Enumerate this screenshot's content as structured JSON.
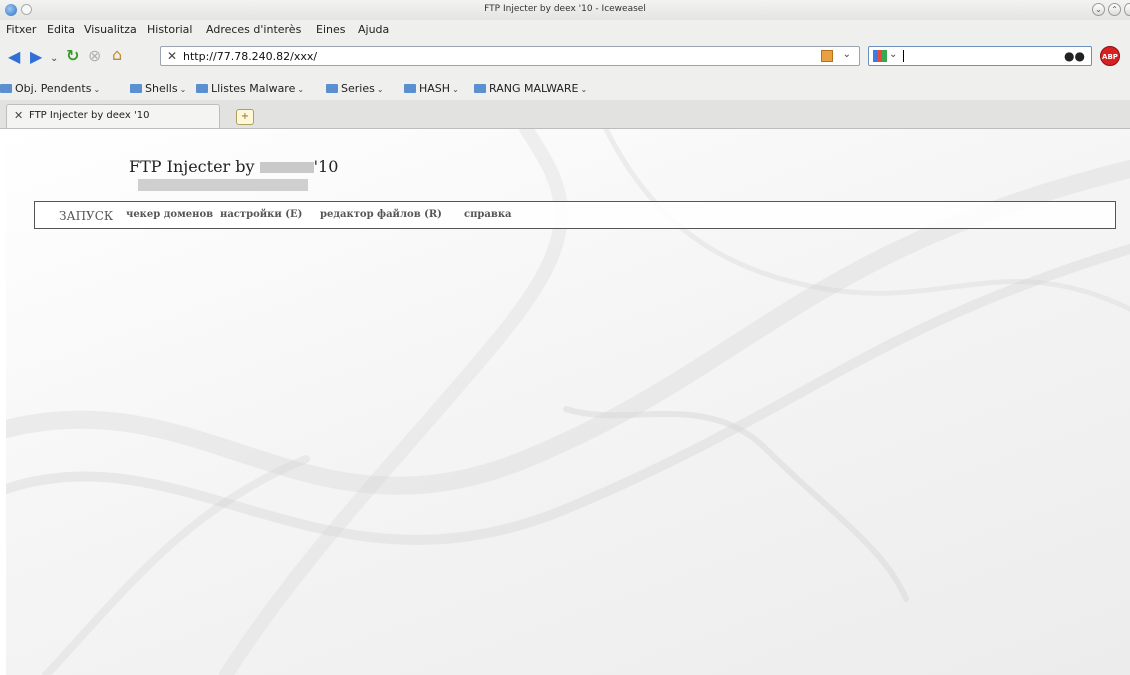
{
  "window": {
    "title": "FTP Injecter by deex '10 - Iceweasel"
  },
  "menu": {
    "items": [
      "Fitxer",
      "Edita",
      "Visualitza",
      "Historial",
      "Adreces d'interès",
      "Eines",
      "Ajuda"
    ]
  },
  "toolbar": {
    "url": "http://77.78.240.82/xxx/",
    "search_value": "",
    "abp_label": "ABP"
  },
  "bookmarks": {
    "items": [
      "Obj. Pendents",
      "Shells",
      "Llistes Malware",
      "Series",
      "HASH",
      "RANG MALWARE"
    ]
  },
  "tabs": {
    "items": [
      {
        "label": "FTP Injecter by deex '10",
        "active": true
      }
    ]
  },
  "page": {
    "title_prefix": "FTP Injecter by",
    "title_suffix": "'10",
    "nav": {
      "run": "ЗАПУСК",
      "items": [
        "чекер доменов",
        "настройки (E)",
        "редактор файлов (R)",
        "справка"
      ]
    }
  },
  "colors": {
    "window_chrome": "#efefed",
    "abp_red": "#d82020",
    "folder_blue": "#5a8fd0",
    "nav_text": "#555555"
  },
  "icons": {
    "back": "back-arrow-icon",
    "forward": "forward-arrow-icon",
    "reload": "reload-icon",
    "stop": "stop-icon",
    "home": "home-icon",
    "site": "tools-icon",
    "search": "binoculars-icon"
  }
}
